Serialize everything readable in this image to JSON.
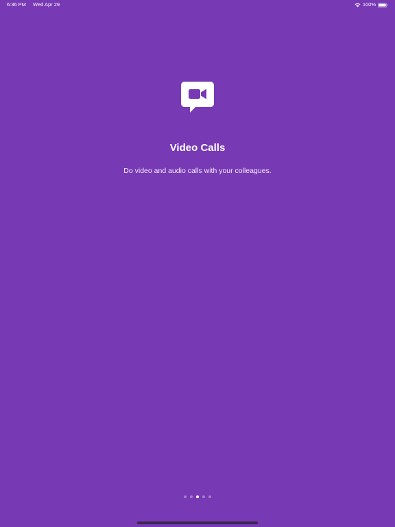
{
  "status_bar": {
    "time": "6:36 PM",
    "date": "Wed Apr 29",
    "battery": "100%"
  },
  "onboarding": {
    "icon": "video-chat-icon",
    "title": "Video Calls",
    "description": "Do video and audio calls with your colleagues.",
    "page_count": 5,
    "current_page": 3
  },
  "colors": {
    "background": "#7839b5",
    "text": "#ffffff"
  }
}
